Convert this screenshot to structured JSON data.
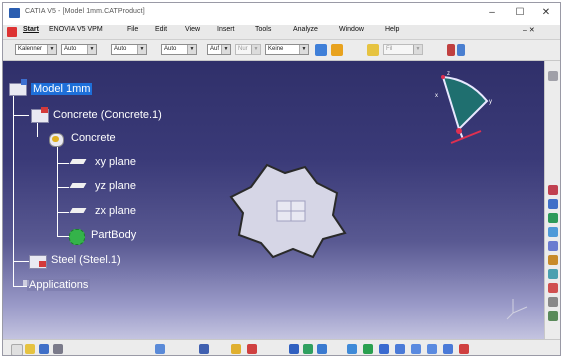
{
  "window": {
    "title": "CATIA V5 - [Model 1mm.CATProduct]",
    "minimize": "–",
    "maximize": "☐",
    "close": "✕"
  },
  "menu": [
    "Start",
    "ENOVIA V5 VPM",
    "File",
    "Edit",
    "View",
    "Insert",
    "Tools",
    "Analyze",
    "Window",
    "Help"
  ],
  "toolbar": {
    "combos": [
      "Kalenner",
      "Auto",
      "Auto",
      "Auto",
      "Auf",
      "Nur",
      "Keine"
    ],
    "layer_combo": "Fil"
  },
  "tree": {
    "root": "Model 1mm",
    "product_1": "Concrete (Concrete.1)",
    "part_1": "Concrete",
    "planes": [
      "xy plane",
      "yz plane",
      "zx plane"
    ],
    "body": "PartBody",
    "product_2": "Steel  (Steel.1)",
    "applications": "Applications"
  },
  "compass": {
    "label_x": "x",
    "label_y": "y",
    "label_z": "z"
  },
  "icons": {
    "title_app": "catia-logo-icon",
    "product": "product-icon",
    "part": "part-icon",
    "plane": "plane-icon",
    "body": "partbody-gear-icon",
    "applications": "applications-icon"
  },
  "colors": {
    "viewport_top": "#30306a",
    "viewport_bottom": "#c4c4e0",
    "selection": "#1e6fd9",
    "part_face": "#d6d6e6"
  }
}
